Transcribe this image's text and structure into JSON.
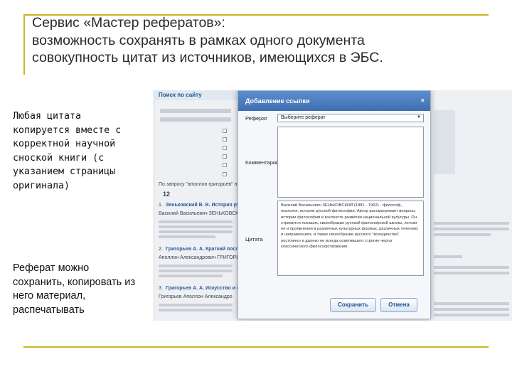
{
  "slide": {
    "title_lines": [
      "Сервис «Мастер рефератов»:",
      "возможность сохранять в рамках одного документа",
      "совокупность цитат из источников, имеющихся в ЭБС."
    ],
    "left_text_1": "Любая цитата копируется вместе с корректной научной сноской книги (с указанием страницы оригинала)",
    "left_text_2": "Реферат можно сохранить, копировать из него материал, распечатывать"
  },
  "background_page": {
    "search_header": "Поиск по сайту",
    "result_query": "По запросу \"аполлон григорьев\" н",
    "result_count": "12",
    "result_1_num": "1.",
    "result_1_link": "Зеньковский В. В. История русс",
    "result_1_author": "Василий Васильевич ЗЕНЬКОВСКИ",
    "result_2_num": "2.",
    "result_2_link": "Григорьев А. А. Краткий посл",
    "result_2_author": "Аполлон Александрович ГРИГОРЬ",
    "result_3_num": "3.",
    "result_3_link": "Григорьев А. А. Искусство и н",
    "result_3_author": "Григорьев Аполлон Александро"
  },
  "dialog": {
    "title": "Добавление ссылки",
    "close_glyph": "×",
    "label_referat": "Реферат",
    "select_value": "Выберите реферат",
    "label_comment": "Комментарий",
    "label_quote": "Цитата",
    "quote_text": "Василий Васильевич ЗЕНЬКОВСКИЙ (1881 - 1962) - философ, психолог, историк русской философии. Автор рассматривает вопросы истории философии в контексте развития национальной культуры. Он стремится показать своеобразие русской философской школы, истоки ее и проявления в различных культурных формах, различных течениях и направлениях, в также своеобразие русского \"всеединства\", постоянно и далеко не всегда осветившего строгие черты классического философствования.",
    "save_label": "Сохранить",
    "cancel_label": "Отмена"
  }
}
